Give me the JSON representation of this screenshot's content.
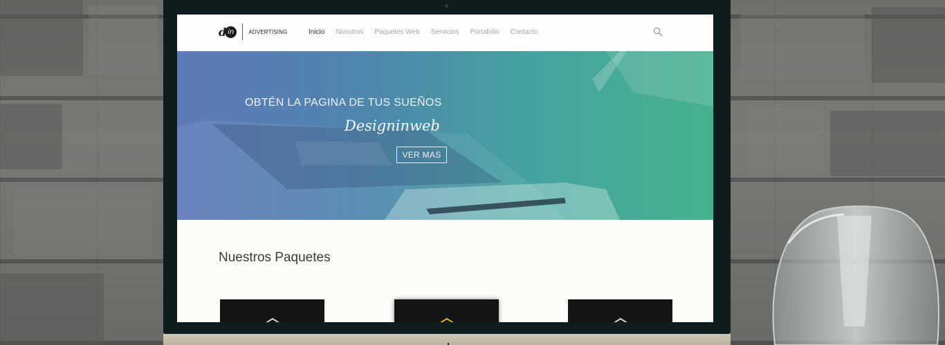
{
  "nav": {
    "logo_mark": "d",
    "logo_circle": "in",
    "logo_text": "ADVERTISING",
    "items": [
      {
        "label": "Inicio",
        "active": true
      },
      {
        "label": "Nosotros",
        "active": false
      },
      {
        "label": "Paquetes Web",
        "active": false
      },
      {
        "label": "Servicios",
        "active": false
      },
      {
        "label": "Portafolio",
        "active": false
      },
      {
        "label": "Contacto",
        "active": false
      }
    ],
    "search_icon": "search-icon"
  },
  "hero": {
    "title": "OBTÉN LA PAGINA DE TUS SUEÑOS",
    "script": "Designinweb",
    "button_label": "VER MAS"
  },
  "packages": {
    "title": "Nuestros Paquetes",
    "items": [
      {
        "icon": "chevron-up-icon",
        "accent": "#d9d9d9"
      },
      {
        "icon": "chevron-up-icon",
        "accent": "#e6b520"
      },
      {
        "icon": "chevron-up-icon",
        "accent": "#d9d9d9"
      }
    ]
  },
  "colors": {
    "hero_start": "#6079b8",
    "hero_end": "#47b18e",
    "featured_accent": "#e6b520"
  }
}
